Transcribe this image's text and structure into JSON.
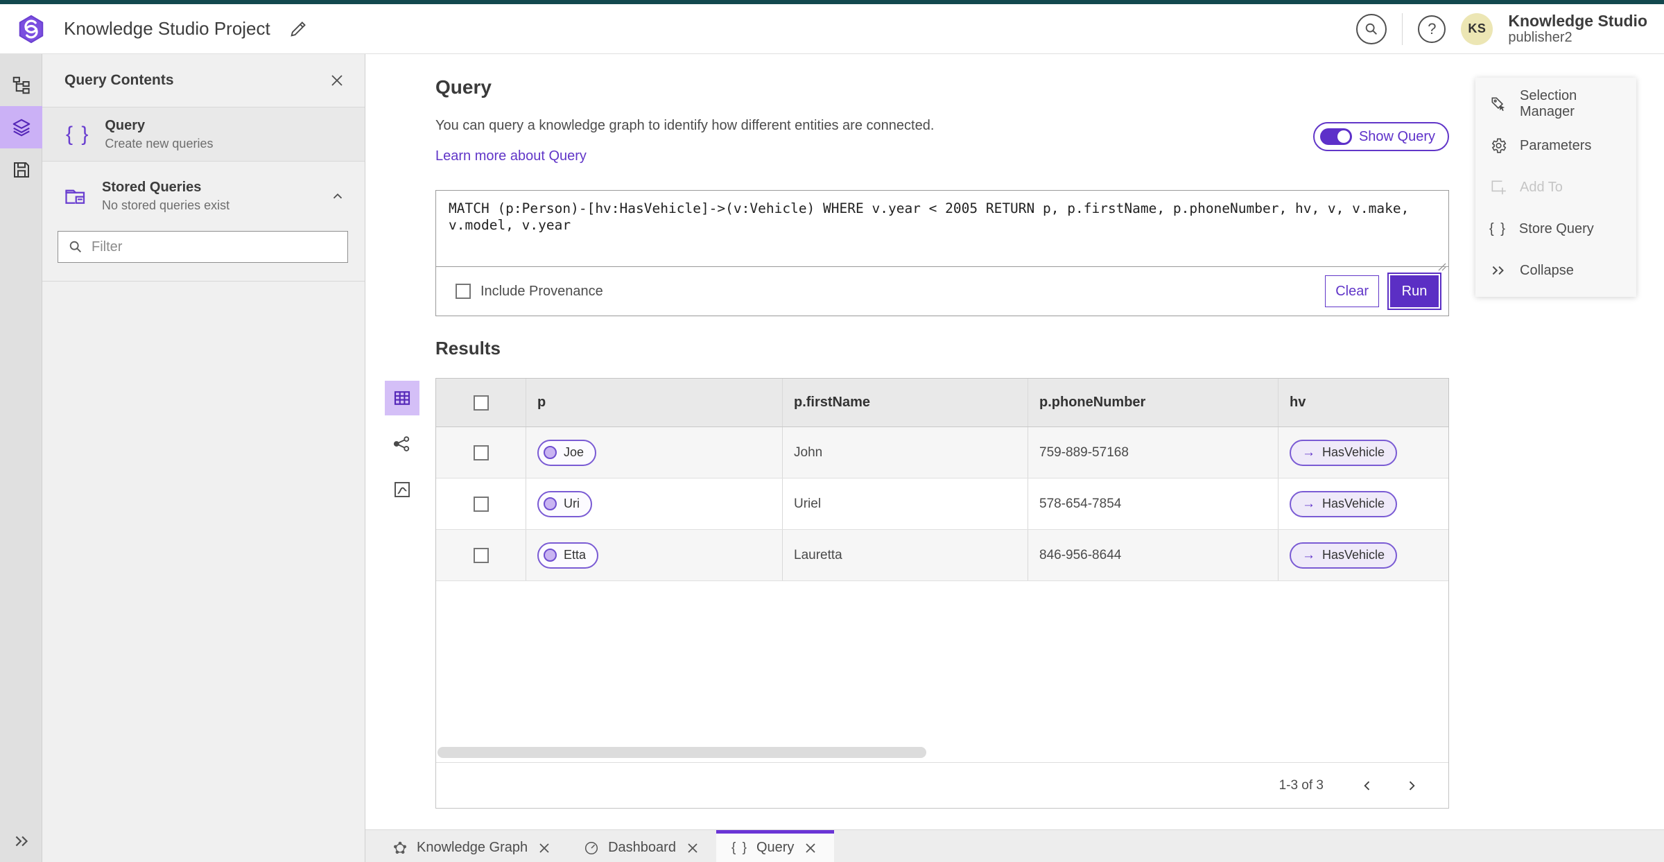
{
  "colors": {
    "accent_purple": "#5d30c9",
    "accent_light_purple": "#cbb1f6",
    "topbar_teal": "#12484e",
    "avatar_yellow": "#ece6b4",
    "panel_gray": "#f0f0f0",
    "table_header_gray": "#e9e9e9"
  },
  "header": {
    "app_title": "Knowledge Studio Project",
    "product_name": "Knowledge Studio",
    "user_role": "publisher2",
    "avatar_initials": "KS"
  },
  "query_contents_panel": {
    "title": "Query Contents",
    "query_item": {
      "label": "Query",
      "description": "Create new queries"
    },
    "stored_queries": {
      "label": "Stored Queries",
      "description": "No stored queries exist"
    },
    "filter_placeholder": "Filter"
  },
  "query_section": {
    "title": "Query",
    "description": "You can query a knowledge graph to identify how different entities are connected.",
    "learn_more_link": "Learn more about Query",
    "show_query_label": "Show Query",
    "show_query_enabled": true,
    "query_text": "MATCH (p:Person)-[hv:HasVehicle]->(v:Vehicle) WHERE v.year < 2005 RETURN p, p.firstName, p.phoneNumber, hv, v, v.make, v.model, v.year",
    "include_provenance_label": "Include Provenance",
    "include_provenance_checked": false,
    "clear_button": "Clear",
    "run_button": "Run"
  },
  "side_actions": [
    {
      "label": "Selection Manager",
      "disabled": false
    },
    {
      "label": "Parameters",
      "disabled": false
    },
    {
      "label": "Add To",
      "disabled": true
    },
    {
      "label": "Store Query",
      "disabled": false
    },
    {
      "label": "Collapse",
      "disabled": false
    }
  ],
  "results": {
    "title": "Results",
    "columns": [
      "p",
      "p.firstName",
      "p.phoneNumber",
      "hv"
    ],
    "rows": [
      {
        "p": "Joe",
        "p_firstName": "John",
        "p_phoneNumber": "759-889-57168",
        "hv": "HasVehicle"
      },
      {
        "p": "Uri",
        "p_firstName": "Uriel",
        "p_phoneNumber": "578-654-7854",
        "hv": "HasVehicle"
      },
      {
        "p": "Etta",
        "p_firstName": "Lauretta",
        "p_phoneNumber": "846-956-8644",
        "hv": "HasVehicle"
      }
    ],
    "pagination": {
      "range_label": "1-3 of 3"
    }
  },
  "bottom_tabs": [
    {
      "label": "Knowledge Graph",
      "active": false
    },
    {
      "label": "Dashboard",
      "active": false
    },
    {
      "label": "Query",
      "active": true
    }
  ],
  "icons": {
    "arrow_right": "→",
    "braces": "{ }"
  }
}
